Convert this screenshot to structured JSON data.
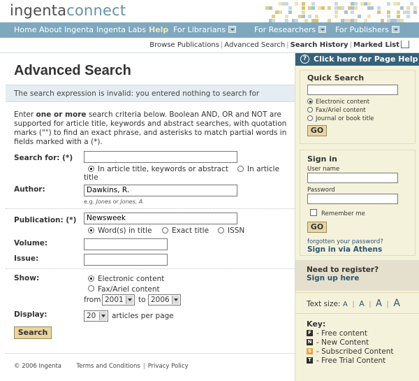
{
  "header": {
    "logo_part1": "ingenta",
    "logo_part2": "connect",
    "nav": {
      "home": "Home",
      "about": "About Ingenta",
      "labs": "Ingenta Labs",
      "help": "Help",
      "librarians": "For Librarians",
      "researchers": "For Researchers",
      "publishers": "For Publishers"
    },
    "subnav": {
      "browse": "Browse Publications",
      "advanced": "Advanced Search",
      "history": "Search History",
      "marked": "Marked List"
    }
  },
  "main": {
    "title": "Advanced Search",
    "error": "The search expression is invalid: you entered nothing to search for",
    "intro_1": "Enter ",
    "intro_bold": "one or more",
    "intro_2": " search criteria below. Boolean AND, OR and NOT are supported for article title, keywords and abstract searches, with quotation marks (\"\") to find an exact phrase, and asterisks to match partial words in fields marked with a (*).",
    "search_for_label": "Search for: (*)",
    "search_for_value": "",
    "scope_option_1": "In article title, keywords or abstract",
    "scope_option_2": "In article",
    "scope_option_2b": "title",
    "author_label": "Author:",
    "author_value": "Dawkins, R.",
    "author_hint_1": "e.g. ",
    "author_hint_2": "Jones",
    "author_hint_3": " or ",
    "author_hint_4": "Jones, A",
    "publication_label": "Publication: (*)",
    "publication_value": "Newsweek",
    "pub_option_1": "Word(s) in title",
    "pub_option_2": "Exact title",
    "pub_option_3": "ISSN",
    "volume_label": "Volume:",
    "volume_value": "",
    "issue_label": "Issue:",
    "issue_value": "",
    "show_label": "Show:",
    "show_option_1": "Electronic content",
    "show_option_2": "Fax/Ariel content",
    "from_label": "from",
    "from_value": "2001",
    "to_label": "to",
    "to_value": "2006",
    "display_label": "Display:",
    "display_value": "20",
    "display_suffix": "articles per page",
    "search_button": "Search",
    "footer_copyright": "© 2006 Ingenta",
    "footer_terms": "Terms and Conditions",
    "footer_sep": "|",
    "footer_privacy": "Privacy Policy"
  },
  "sidebar": {
    "help_bar": "Click here for Page Help",
    "help_icon": "?",
    "quick_search_title": "Quick Search",
    "quick_search_value": "",
    "qs_option_1": "Electronic content",
    "qs_option_2": "Fax/Ariel content",
    "qs_option_3": "Journal or book title",
    "go_label": "GO",
    "sign_in_title": "Sign in",
    "username_label": "User name",
    "password_label": "Password",
    "remember_label": "Remember me",
    "forgotten": "forgotten your password?",
    "athens": "Sign in via Athens",
    "register_q": "Need to register?",
    "register_link": "Sign up here",
    "text_size_label": "Text size:",
    "text_size_a": "A",
    "text_size_sep": "|",
    "key_title": "Key:",
    "key": [
      {
        "icon": "F",
        "label": "- Free content",
        "color": "#2b2b2b"
      },
      {
        "icon": "N",
        "label": "- New Content",
        "color": "#2b2b2b"
      },
      {
        "icon": "S",
        "label": "- Subscribed Content",
        "color": "#e6a43a"
      },
      {
        "icon": "T",
        "label": "- Free Trial Content",
        "color": "#2b2b2b"
      }
    ]
  }
}
